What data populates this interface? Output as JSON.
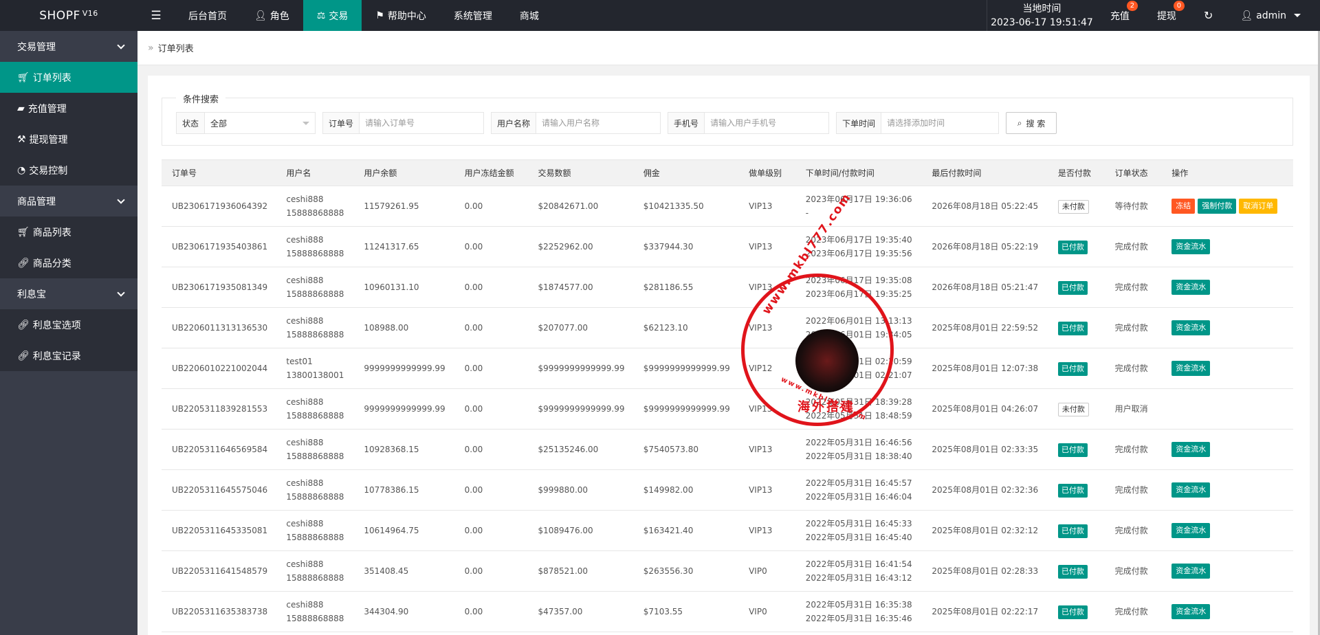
{
  "app": {
    "logo": "SHOPF",
    "version": "V16"
  },
  "nav": [
    {
      "label": "后台首页",
      "icon": ""
    },
    {
      "label": "角色",
      "icon": "user-icon"
    },
    {
      "label": "交易",
      "icon": "scale-icon"
    },
    {
      "label": "帮助中心",
      "icon": "flag-icon"
    },
    {
      "label": "系统管理",
      "icon": ""
    },
    {
      "label": "商城",
      "icon": ""
    }
  ],
  "topright": {
    "clock_label": "当地时间",
    "clock_value": "2023-06-17 19:51:47",
    "recharge": "充值",
    "recharge_badge": "2",
    "withdraw": "提现",
    "withdraw_badge": "0",
    "user": "admin"
  },
  "sidebar": {
    "groups": [
      {
        "label": "交易管理",
        "items": [
          "订单列表",
          "充值管理",
          "提现管理",
          "交易控制"
        ]
      },
      {
        "label": "商品管理",
        "items": [
          "商品列表",
          "商品分类"
        ]
      },
      {
        "label": "利息宝",
        "items": [
          "利息宝选项",
          "利息宝记录"
        ]
      }
    ]
  },
  "breadcrumb": "订单列表",
  "search": {
    "legend": "条件搜索",
    "status_label": "状态",
    "status_value": "全部",
    "order_label": "订单号",
    "order_placeholder": "请输入订单号",
    "username_label": "用户名称",
    "username_placeholder": "请输入用户名称",
    "phone_label": "手机号",
    "phone_placeholder": "请输入用户手机号",
    "time_label": "下单时间",
    "time_placeholder": "请选择添加时间",
    "button": "搜 索"
  },
  "table": {
    "headers": [
      "订单号",
      "用户名",
      "用户余额",
      "用户冻结金额",
      "交易数额",
      "佣金",
      "做单级别",
      "下单时间/付款时间",
      "最后付款时间",
      "是否付款",
      "订单状态",
      "操作"
    ],
    "rows": [
      {
        "order": "UB2306171936064392",
        "user": "ceshi888",
        "phone": "15888868888",
        "balance": "11579261.95",
        "frozen": "0.00",
        "amount": "$20842671.00",
        "commission": "$10421335.50",
        "level": "VIP13",
        "t1": "2023年06月17日 19:36:06",
        "t2": "-",
        "last": "2026年08月18日 05:22:45",
        "paid": "未付款",
        "status": "等待付款",
        "actions": [
          "冻结",
          "强制付款",
          "取消订单"
        ]
      },
      {
        "order": "UB2306171935403861",
        "user": "ceshi888",
        "phone": "15888868888",
        "balance": "11241317.65",
        "frozen": "0.00",
        "amount": "$2252962.00",
        "commission": "$337944.30",
        "level": "VIP13",
        "t1": "2023年06月17日 19:35:40",
        "t2": "2023年06月17日 19:35:56",
        "last": "2026年08月18日 05:22:19",
        "paid": "已付款",
        "status": "完成付款",
        "actions": [
          "资金流水"
        ]
      },
      {
        "order": "UB2306171935081349",
        "user": "ceshi888",
        "phone": "15888868888",
        "balance": "10960131.10",
        "frozen": "0.00",
        "amount": "$1874577.00",
        "commission": "$281186.55",
        "level": "VIP13",
        "t1": "2023年06月17日 19:35:08",
        "t2": "2023年06月17日 19:35:25",
        "last": "2026年08月18日 05:21:47",
        "paid": "已付款",
        "status": "完成付款",
        "actions": [
          "资金流水"
        ]
      },
      {
        "order": "UB2206011313136530",
        "user": "ceshi888",
        "phone": "15888868888",
        "balance": "108988.00",
        "frozen": "0.00",
        "amount": "$207077.00",
        "commission": "$62123.10",
        "level": "VIP13",
        "t1": "2022年06月01日 13:13:13",
        "t2": "2022年06月01日 19:34:05",
        "last": "2025年08月01日 22:59:52",
        "paid": "已付款",
        "status": "完成付款",
        "actions": [
          "资金流水"
        ]
      },
      {
        "order": "UB2206010221002044",
        "user": "test01",
        "phone": "13800138001",
        "balance": "9999999999999.99",
        "frozen": "0.00",
        "amount": "$9999999999999.99",
        "commission": "$9999999999999.99",
        "level": "VIP12",
        "t1": "2022年06月01日 02:20:59",
        "t2": "2022年06月01日 02:21:07",
        "last": "2025年08月01日 12:07:38",
        "paid": "已付款",
        "status": "完成付款",
        "actions": [
          "资金流水"
        ]
      },
      {
        "order": "UB2205311839281553",
        "user": "ceshi888",
        "phone": "15888868888",
        "balance": "9999999999999.99",
        "frozen": "0.00",
        "amount": "$9999999999999.99",
        "commission": "$9999999999999.99",
        "level": "VIP13",
        "t1": "2022年05月31日 18:39:28",
        "t2": "2022年05月31日 18:48:59",
        "last": "2025年08月01日 04:26:07",
        "paid": "未付款",
        "status": "用户取消",
        "actions": []
      },
      {
        "order": "UB2205311646569584",
        "user": "ceshi888",
        "phone": "15888868888",
        "balance": "10928368.15",
        "frozen": "0.00",
        "amount": "$25135246.00",
        "commission": "$7540573.80",
        "level": "VIP13",
        "t1": "2022年05月31日 16:46:56",
        "t2": "2022年05月31日 18:38:40",
        "last": "2025年08月01日 02:33:35",
        "paid": "已付款",
        "status": "完成付款",
        "actions": [
          "资金流水"
        ]
      },
      {
        "order": "UB2205311645575046",
        "user": "ceshi888",
        "phone": "15888868888",
        "balance": "10778386.15",
        "frozen": "0.00",
        "amount": "$999880.00",
        "commission": "$149982.00",
        "level": "VIP13",
        "t1": "2022年05月31日 16:45:57",
        "t2": "2022年05月31日 16:46:04",
        "last": "2025年08月01日 02:32:36",
        "paid": "已付款",
        "status": "完成付款",
        "actions": [
          "资金流水"
        ]
      },
      {
        "order": "UB2205311645335081",
        "user": "ceshi888",
        "phone": "15888868888",
        "balance": "10614964.75",
        "frozen": "0.00",
        "amount": "$1089476.00",
        "commission": "$163421.40",
        "level": "VIP13",
        "t1": "2022年05月31日 16:45:33",
        "t2": "2022年05月31日 16:45:40",
        "last": "2025年08月01日 02:32:12",
        "paid": "已付款",
        "status": "完成付款",
        "actions": [
          "资金流水"
        ]
      },
      {
        "order": "UB2205311641548579",
        "user": "ceshi888",
        "phone": "15888868888",
        "balance": "351408.45",
        "frozen": "0.00",
        "amount": "$878521.00",
        "commission": "$263556.30",
        "level": "VIP0",
        "t1": "2022年05月31日 16:41:54",
        "t2": "2022年05月31日 16:43:12",
        "last": "2025年08月01日 02:28:33",
        "paid": "已付款",
        "status": "完成付款",
        "actions": [
          "资金流水"
        ]
      },
      {
        "order": "UB2205311635383738",
        "user": "ceshi888",
        "phone": "15888868888",
        "balance": "344304.90",
        "frozen": "0.00",
        "amount": "$47357.00",
        "commission": "$7103.55",
        "level": "VIP0",
        "t1": "2022年05月31日 16:35:38",
        "t2": "2022年05月31日 16:35:46",
        "last": "2025年08月01日 02:22:17",
        "paid": "已付款",
        "status": "完成付款",
        "actions": [
          "资金流水"
        ]
      }
    ]
  },
  "watermark": {
    "url_top": "www.mkbl777.com",
    "url_bottom": "www.mkbl777.com",
    "caption": "海外搭建"
  },
  "colors": {
    "accent": "#009688",
    "topbar": "#23262e",
    "sidebar": "#393d49",
    "danger": "#ff5722",
    "warn": "#ffb800",
    "stamp": "#e0141b"
  }
}
